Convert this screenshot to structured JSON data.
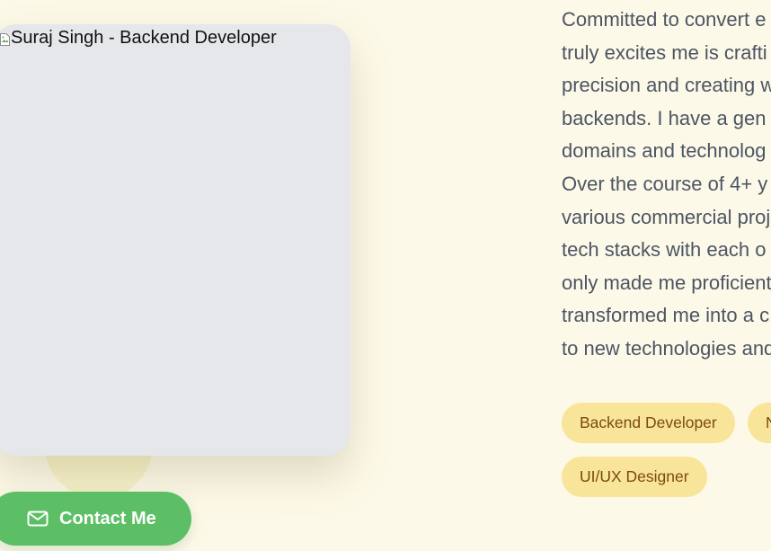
{
  "profile": {
    "photo_alt": "Suraj Singh - Backend Developer"
  },
  "contact": {
    "label": "Contact Me",
    "icon": "mail-icon",
    "color": "#5cbf65"
  },
  "bio": {
    "lines": [
      "Committed to convert e",
      "truly excites me is crafti",
      "precision and creating w",
      "backends. I have a gen",
      "domains and technolog",
      "Over the course of 4+ y",
      "various commercial proj",
      "tech stacks with each o",
      "only made me proficient",
      "transformed me into a c",
      "to new technologies and"
    ]
  },
  "tags": [
    {
      "label": "Backend Developer"
    },
    {
      "label": "N"
    },
    {
      "label": "UI/UX Designer"
    }
  ],
  "colors": {
    "background": "#fdf9e8",
    "tag_bg": "#f8e59a",
    "tag_text": "#7c4a0e",
    "photo_placeholder": "#e5e7eb"
  }
}
